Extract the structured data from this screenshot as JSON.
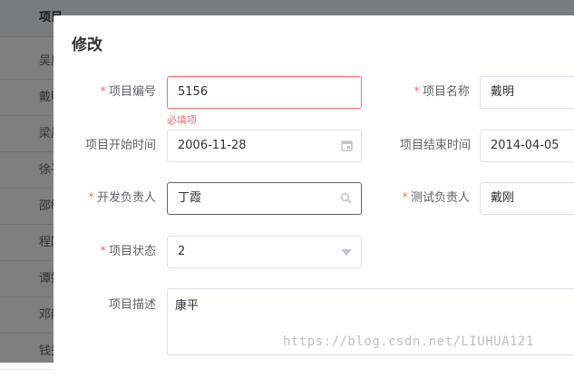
{
  "background_table": {
    "header": "项目",
    "rows": [
      "吴凤",
      "戴明",
      "梁晨",
      "徐平",
      "邵敏",
      "程刚",
      "谭娟",
      "邓静",
      "钱秀"
    ]
  },
  "modal": {
    "title": "修改",
    "fields": {
      "project_no": {
        "label": "项目编号",
        "value": "5156",
        "error": "必填项",
        "required": true
      },
      "project_name": {
        "label": "项目名称",
        "value": "戴明",
        "required": true
      },
      "start_time": {
        "label": "项目开始时间",
        "value": "2006-11-28",
        "icon": "calendar-icon"
      },
      "end_time": {
        "label": "项目结束时间",
        "value": "2014-04-05"
      },
      "dev_owner": {
        "label": "开发负责人",
        "value": "丁霞",
        "icon": "search-icon",
        "required": true
      },
      "test_owner": {
        "label": "测试负责人",
        "value": "戴刚",
        "required": true
      },
      "status": {
        "label": "项目状态",
        "value": "2",
        "icon": "chevron-down-icon",
        "required": true
      },
      "description": {
        "label": "项目描述",
        "value": "康平"
      }
    }
  },
  "watermark": "https://blog.csdn.net/LIUHUA121",
  "colors": {
    "required": "#f56c6c",
    "border": "#dcdfe6",
    "text": "#606266"
  }
}
